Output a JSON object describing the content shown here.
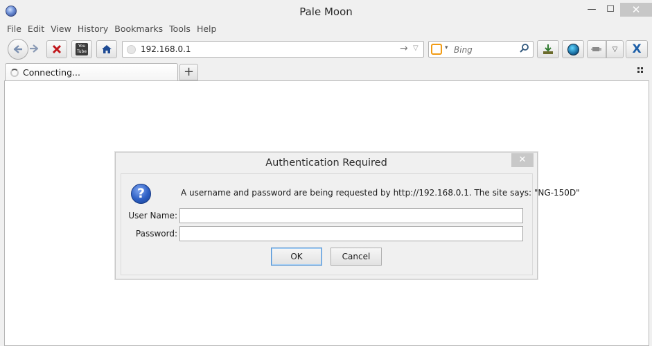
{
  "window": {
    "title": "Pale Moon",
    "minimize_glyph": "—",
    "maximize_glyph": "☐",
    "close_glyph": "✕"
  },
  "menu": {
    "items": [
      "File",
      "Edit",
      "View",
      "History",
      "Bookmarks",
      "Tools",
      "Help"
    ]
  },
  "toolbar": {
    "back_icon": "back-arrow-icon",
    "forward_icon": "forward-arrow-icon",
    "stop_icon": "stop-icon",
    "youtube_label": "You\nTube",
    "home_icon": "home-icon",
    "url": "192.168.0.1",
    "go_glyph": "→",
    "url_dropdown_glyph": "▽",
    "search_placeholder": "Bing",
    "search_dropdown_glyph": "▾",
    "search_go_glyph": "⌕",
    "downloads_icon": "download-icon",
    "addon_icon": "globe-icon",
    "extension_icon": "plugin-icon",
    "menu_dropdown_glyph": "▽",
    "xmarks_label": "X"
  },
  "tabs": {
    "items": [
      {
        "label": "Connecting...",
        "loading": true
      }
    ],
    "new_tab_glyph": "+"
  },
  "dialog": {
    "title": "Authentication Required",
    "close_glyph": "✕",
    "icon": "question-icon",
    "icon_glyph": "?",
    "message": "A username and password are being requested by http://192.168.0.1. The site says: \"NG-150D\"",
    "username_label": "User Name:",
    "username_value": "",
    "password_label": "Password:",
    "password_value": "",
    "ok_label": "OK",
    "cancel_label": "Cancel"
  },
  "colors": {
    "accent_blue": "#2d5fc4",
    "stop_red": "#c0161b",
    "home_blue": "#1f4b94",
    "search_orange": "#f19b14",
    "xmarks_blue": "#1d5fa8"
  }
}
